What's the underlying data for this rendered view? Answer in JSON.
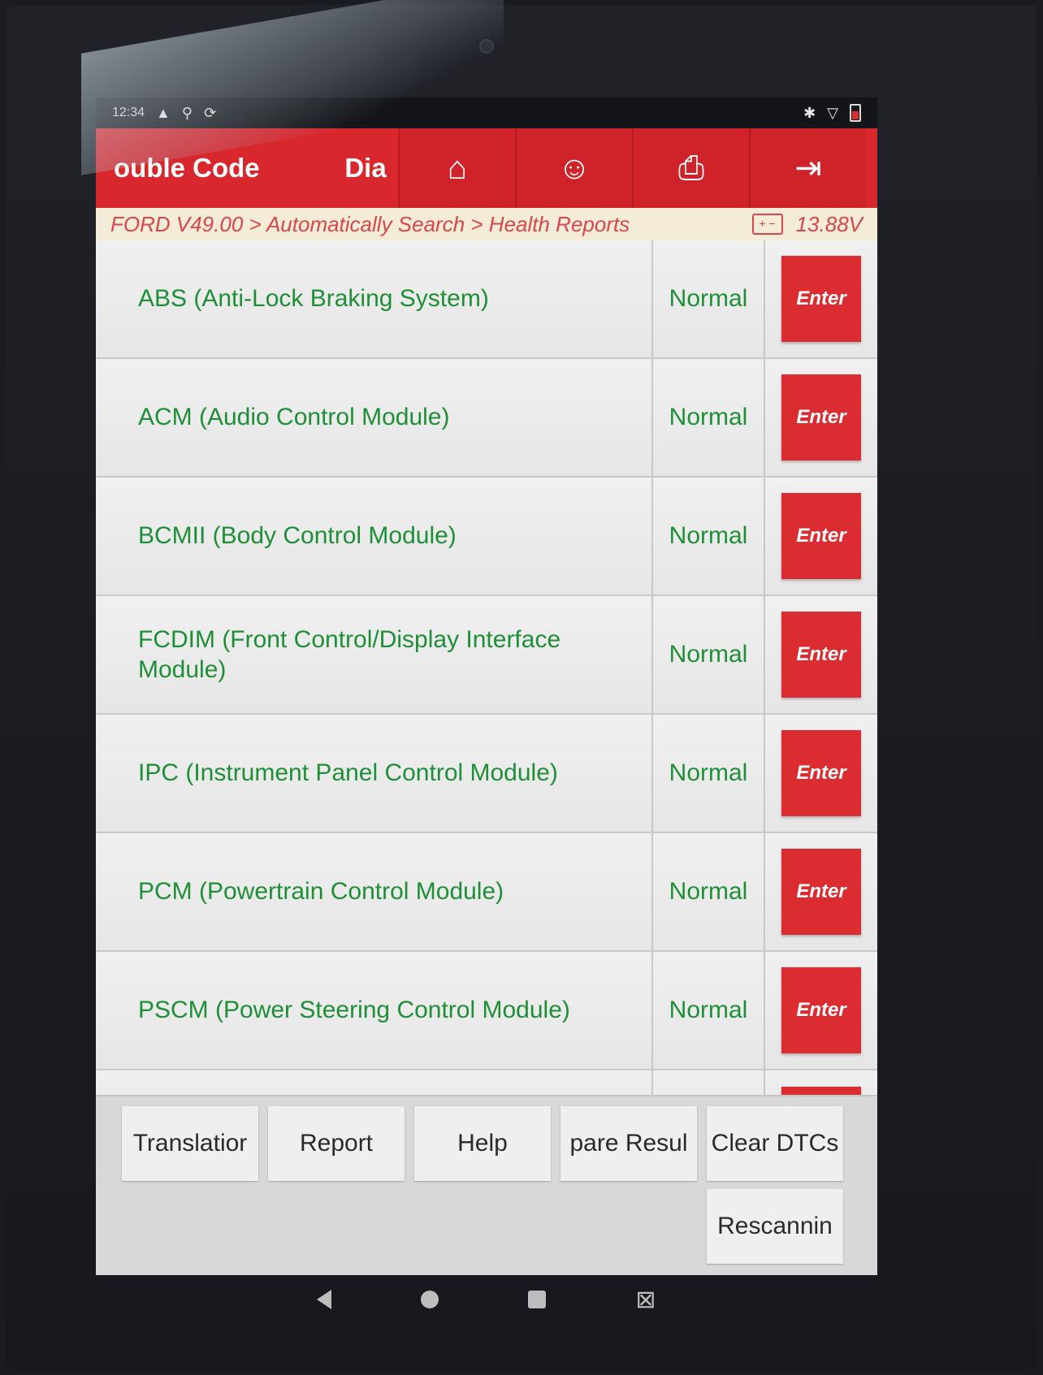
{
  "status_bar": {
    "time": "12:34",
    "left_icons": [
      "alert-icon",
      "usb-icon",
      "sync-icon"
    ],
    "right_icons": [
      "bluetooth-icon",
      "wifi-icon",
      "battery-icon"
    ]
  },
  "toolbar": {
    "title": "ouble Code",
    "menu_label": "Dia",
    "buttons": [
      {
        "name": "home-button",
        "icon": "home-icon",
        "glyph": "⌂"
      },
      {
        "name": "support-button",
        "icon": "user-headset-icon",
        "glyph": "☺"
      },
      {
        "name": "print-button",
        "icon": "printer-icon",
        "glyph": "⎙"
      },
      {
        "name": "exit-button",
        "icon": "exit-icon",
        "glyph": "⇥"
      }
    ],
    "colors": {
      "background": "#d9272e"
    }
  },
  "breadcrumb": {
    "path": "FORD V49.00 > Automatically Search > Health Reports",
    "voltage": "13.88V"
  },
  "modules": [
    {
      "name": "ABS (Anti-Lock Braking System)",
      "status": "Normal",
      "action": "Enter"
    },
    {
      "name": "ACM (Audio Control Module)",
      "status": "Normal",
      "action": "Enter"
    },
    {
      "name": "BCMII (Body Control Module)",
      "status": "Normal",
      "action": "Enter"
    },
    {
      "name": "FCDIM (Front Control/Display Interface Module)",
      "status": "Normal",
      "action": "Enter"
    },
    {
      "name": "IPC (Instrument Panel Control Module)",
      "status": "Normal",
      "action": "Enter"
    },
    {
      "name": "PCM (Powertrain Control Module)",
      "status": "Normal",
      "action": "Enter"
    },
    {
      "name": "PSCM (Power Steering Control Module)",
      "status": "Normal",
      "action": "Enter"
    }
  ],
  "bottom_buttons": {
    "translation": "Translatior",
    "report": "Report",
    "help": "Help",
    "compare": "pare Resul",
    "clear": "Clear DTCs",
    "rescan": "Rescannin"
  },
  "colors": {
    "status_text": "#1f8f37",
    "enter_button": "#da2c31",
    "breadcrumb_text": "#d9464b"
  }
}
